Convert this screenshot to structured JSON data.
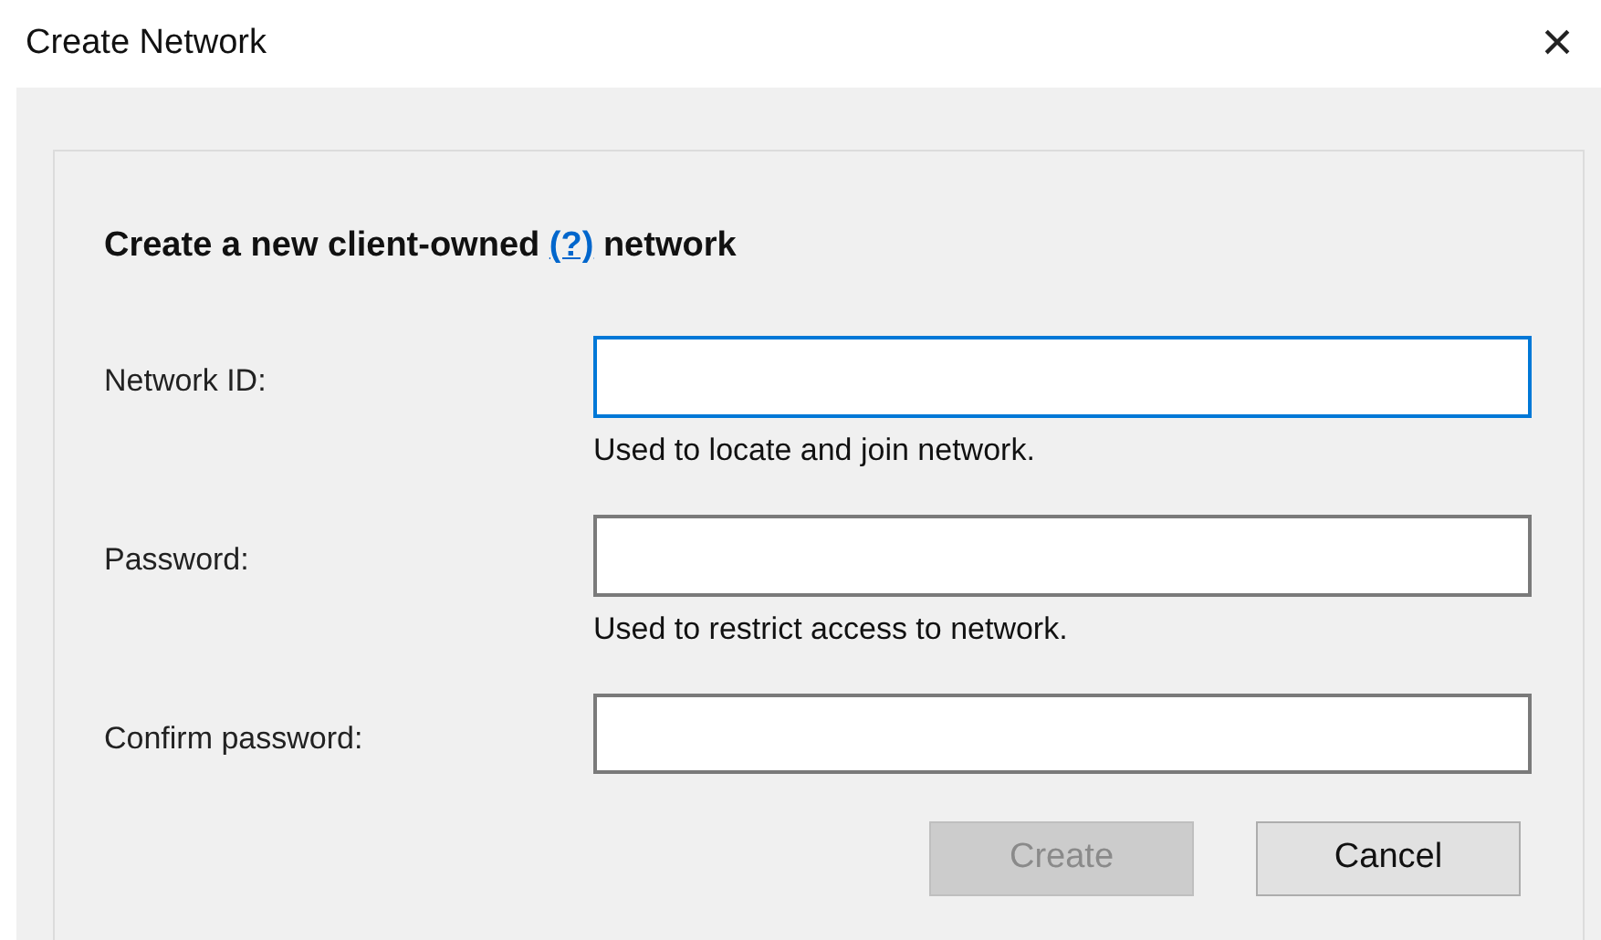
{
  "window": {
    "title": "Create Network",
    "close": "×"
  },
  "heading": {
    "before": "Create a new client-owned",
    "link": "(?)",
    "after": "network"
  },
  "fields": [
    {
      "label": "Network ID:",
      "hint": "Used to locate and join network.",
      "focused": true
    },
    {
      "label": "Password:",
      "hint": "Used to restrict access to network.",
      "focused": false
    },
    {
      "label": "Confirm password:",
      "focused": false
    }
  ],
  "buttons": [
    {
      "label": "Create",
      "disabled": true
    },
    {
      "label": "Cancel",
      "disabled": false
    }
  ]
}
